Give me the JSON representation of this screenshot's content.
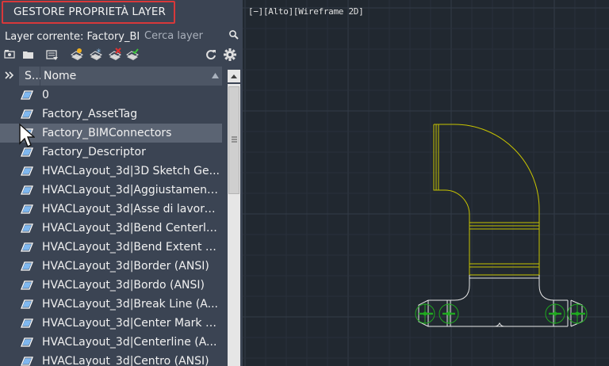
{
  "panel": {
    "title": "GESTORE PROPRIETÀ LAYER",
    "current_layer_label": "Layer corrente: Factory_BIMConnectors",
    "search_placeholder": "Cerca layer",
    "columns": {
      "status": "S...",
      "name": "Nome"
    },
    "layers": [
      {
        "name": "0",
        "selected": false
      },
      {
        "name": "Factory_AssetTag",
        "selected": false
      },
      {
        "name": "Factory_BIMConnectors",
        "selected": true
      },
      {
        "name": "Factory_Descriptor",
        "selected": false
      },
      {
        "name": "HVACLayout_3d|3D Sketch Ge...",
        "selected": false
      },
      {
        "name": "HVACLayout_3d|Aggiustament...",
        "selected": false
      },
      {
        "name": "HVACLayout_3d|Asse di lavoro...",
        "selected": false
      },
      {
        "name": "HVACLayout_3d|Bend Centerli...",
        "selected": false
      },
      {
        "name": "HVACLayout_3d|Bend Extent (...",
        "selected": false
      },
      {
        "name": "HVACLayout_3d|Border (ANSI)",
        "selected": false
      },
      {
        "name": "HVACLayout_3d|Bordo (ANSI)",
        "selected": false
      },
      {
        "name": "HVACLayout_3d|Break Line (A...",
        "selected": false
      },
      {
        "name": "HVACLayout_3d|Center Mark (...",
        "selected": false
      },
      {
        "name": "HVACLayout_3d|Centerline (A...",
        "selected": false
      },
      {
        "name": "HVACLayout_3d|Centro (ANSI)",
        "selected": false
      }
    ]
  },
  "viewport": {
    "label": "[−][Alto][Wireframe 2D]"
  },
  "colors": {
    "panel_bg": "#3b4453",
    "viewport_bg": "#212830",
    "title_border": "#d8383a",
    "geometry_yellow": "#c8c400",
    "geometry_white": "#e8e8e8",
    "connector_green": "#1fa81f"
  }
}
